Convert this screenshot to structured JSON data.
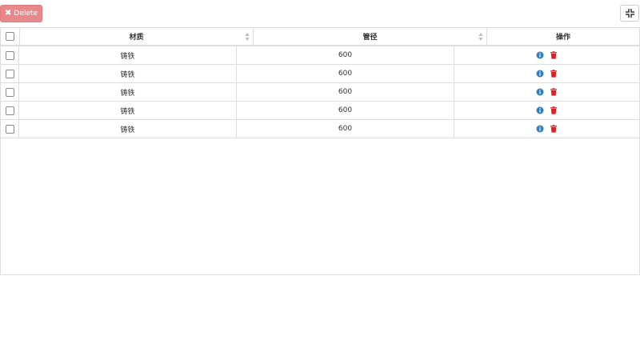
{
  "toolbar": {
    "delete_label": "Delete",
    "delete_icon": "x-icon",
    "fullscreen_icon": "fullscreen-icon"
  },
  "table": {
    "columns": [
      "材质",
      "管径",
      "操作"
    ],
    "rows": [
      {
        "material": "铸铁",
        "diameter": "600"
      },
      {
        "material": "铸铁",
        "diameter": "600"
      },
      {
        "material": "铸铁",
        "diameter": "600"
      },
      {
        "material": "铸铁",
        "diameter": "600"
      },
      {
        "material": "铸铁",
        "diameter": "600"
      }
    ]
  },
  "colors": {
    "delete_button": "#e7898a",
    "info_icon": "#2f7fc1",
    "trash_icon": "#e02020"
  }
}
